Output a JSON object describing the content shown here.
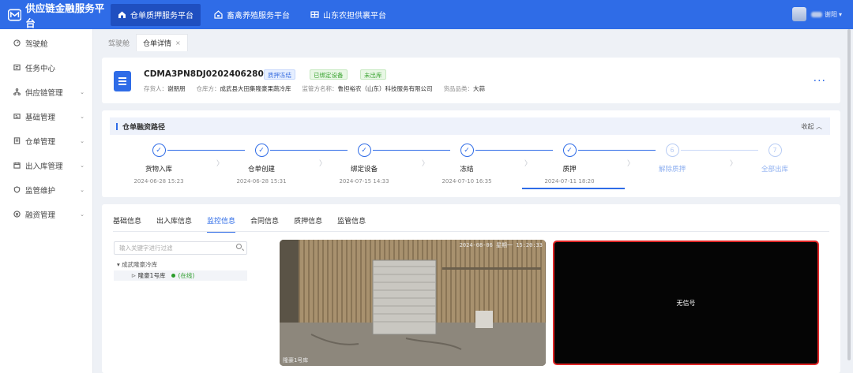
{
  "topbar": {
    "app_title": "供应链金融服务平台",
    "tabs": [
      {
        "label": "仓单质押服务平台",
        "active": true
      },
      {
        "label": "畜禽养殖服务平台",
        "active": false
      },
      {
        "label": "山东农担供裹平台",
        "active": false
      }
    ],
    "user_name": "谢阳"
  },
  "sidebar": {
    "items": [
      {
        "label": "驾驶舱",
        "expandable": false
      },
      {
        "label": "任务中心",
        "expandable": false
      },
      {
        "label": "供应链管理",
        "expandable": true
      },
      {
        "label": "基础管理",
        "expandable": true
      },
      {
        "label": "仓单管理",
        "expandable": true
      },
      {
        "label": "出入库管理",
        "expandable": true
      },
      {
        "label": "监管维护",
        "expandable": true
      },
      {
        "label": "融资管理",
        "expandable": true
      }
    ]
  },
  "page_tabs": [
    {
      "label": "驾驶舱",
      "active": false
    },
    {
      "label": "仓单详情",
      "active": true,
      "close": "×"
    }
  ],
  "receipt": {
    "id": "CDMA3PN8DJ02024062800007",
    "badges": [
      "质押冻结",
      "已绑定设备",
      "未出库"
    ],
    "meta": [
      {
        "label": "存货人：",
        "value": "谢朋朋"
      },
      {
        "label": "仓库方：",
        "value": "成武县大田集隆豪果蔬冷库"
      },
      {
        "label": "监管方名称：",
        "value": "鲁担裕农（山东）科技服务有限公司"
      },
      {
        "label": "货品品类：",
        "value": "大蒜"
      }
    ],
    "more": "···"
  },
  "path": {
    "title": "仓单融资路径",
    "collapse_label": "收起 ︿",
    "steps": [
      {
        "label": "货物入库",
        "time": "2024-06-28 15:23",
        "done": true,
        "mark": "✓"
      },
      {
        "label": "仓单创建",
        "time": "2024-06-28 15:31",
        "done": true,
        "mark": "✓"
      },
      {
        "label": "绑定设备",
        "time": "2024-07-15 14:33",
        "done": true,
        "mark": "✓"
      },
      {
        "label": "冻结",
        "time": "2024-07-10 16:35",
        "done": true,
        "mark": "✓"
      },
      {
        "label": "质押",
        "time": "2024-07-11 18:20",
        "done": true,
        "mark": "✓"
      },
      {
        "label": "解除质押",
        "time": "",
        "done": false,
        "mark": "6"
      },
      {
        "label": "全部出库",
        "time": "",
        "done": false,
        "mark": "7"
      }
    ]
  },
  "info_tabs": [
    {
      "label": "基础信息",
      "active": false
    },
    {
      "label": "出入库信息",
      "active": false
    },
    {
      "label": "监控信息",
      "active": true
    },
    {
      "label": "合同信息",
      "active": false
    },
    {
      "label": "质押信息",
      "active": false
    },
    {
      "label": "监管信息",
      "active": false
    }
  ],
  "monitor": {
    "search_placeholder": "输入关键字进行过滤",
    "tree_root": "成武隆豪冷库",
    "tree_child": "隆豪1号库",
    "tree_child_status": "(在线)",
    "cam1_osd": "2024-08-06 星期一 15:20:33",
    "cam1_label": "隆豪1号库",
    "cam2_text": "无信号"
  }
}
